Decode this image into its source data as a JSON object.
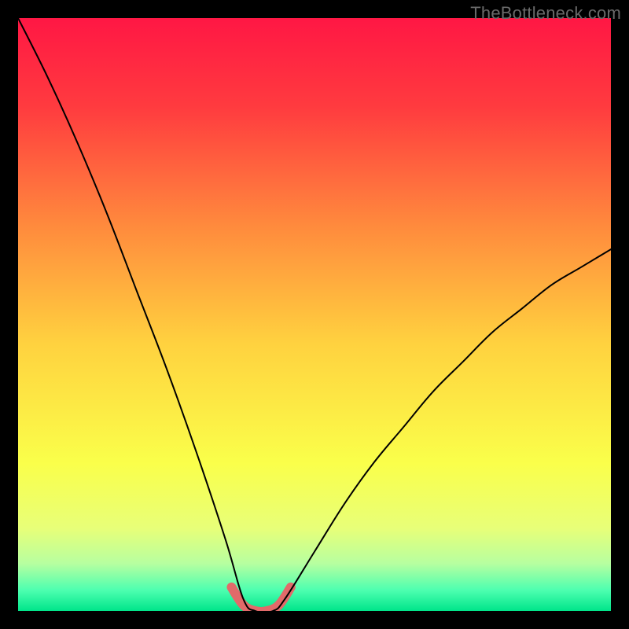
{
  "watermark": "TheBottleneck.com",
  "chart_data": {
    "type": "line",
    "title": "",
    "xlabel": "",
    "ylabel": "",
    "xlim": [
      0,
      100
    ],
    "ylim": [
      0,
      100
    ],
    "grid": false,
    "note": "Bottleneck curve: cost vs. relative performance. Y=0 at the bottom (optimal); peak bottleneck toward the top. No axis tick labels are shown in the image; data below are estimated from the plotted curve.",
    "series": [
      {
        "name": "bottleneck-curve",
        "x": [
          0,
          5,
          10,
          15,
          20,
          25,
          30,
          35,
          38,
          40,
          43,
          45,
          50,
          55,
          60,
          65,
          70,
          75,
          80,
          85,
          90,
          95,
          100
        ],
        "y": [
          100,
          90,
          79,
          67,
          54,
          41,
          27,
          12,
          2,
          0,
          0,
          2,
          10,
          18,
          25,
          31,
          37,
          42,
          47,
          51,
          55,
          58,
          61
        ]
      },
      {
        "name": "optimal-flat-highlight",
        "x": [
          36,
          38,
          40,
          42,
          44,
          46
        ],
        "y": [
          4,
          1,
          0,
          0,
          1,
          4
        ]
      }
    ],
    "gradient_background": {
      "stops": [
        {
          "pos": 0.0,
          "color": "#ff1744"
        },
        {
          "pos": 0.15,
          "color": "#ff3b3f"
        },
        {
          "pos": 0.35,
          "color": "#ff8a3d"
        },
        {
          "pos": 0.55,
          "color": "#ffd23f"
        },
        {
          "pos": 0.75,
          "color": "#faff4a"
        },
        {
          "pos": 0.86,
          "color": "#e8ff78"
        },
        {
          "pos": 0.92,
          "color": "#b7ffa0"
        },
        {
          "pos": 0.965,
          "color": "#4dffb0"
        },
        {
          "pos": 1.0,
          "color": "#00e58a"
        }
      ]
    },
    "styles": {
      "curve_stroke": "#000000",
      "curve_width": 2,
      "highlight_stroke": "#e26a6a",
      "highlight_width": 12
    }
  }
}
